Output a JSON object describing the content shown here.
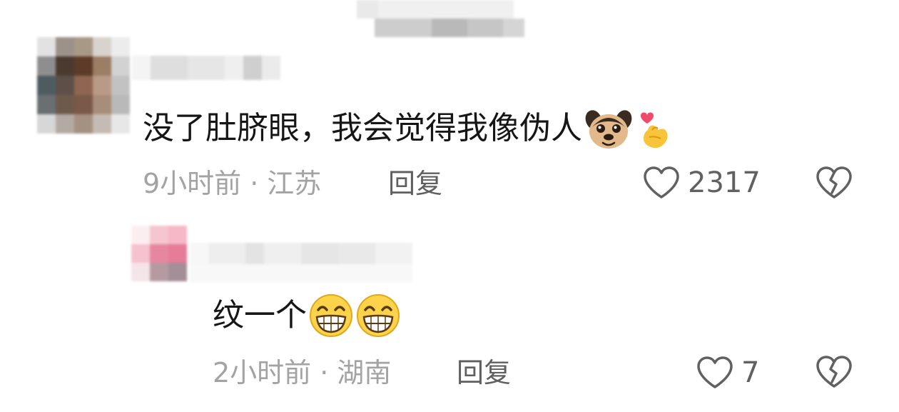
{
  "comments": [
    {
      "text": "没了肚脐眼，我会觉得我像伪人",
      "time": "9小时前",
      "location": "江苏",
      "reply_label": "回复",
      "likes": "2317",
      "emojis": [
        "dog-face-emoji",
        "finger-heart-emoji"
      ]
    },
    {
      "text": "纹一个",
      "time": "2小时前",
      "location": "湖南",
      "reply_label": "回复",
      "likes": "7",
      "emojis": [
        "grinning-face-emoji",
        "grinning-face-emoji"
      ]
    }
  ],
  "separator": "·",
  "colors": {
    "text": "#161616",
    "meta": "#a3a3a3",
    "reply": "#5f5f5f",
    "icon": "#616161"
  }
}
